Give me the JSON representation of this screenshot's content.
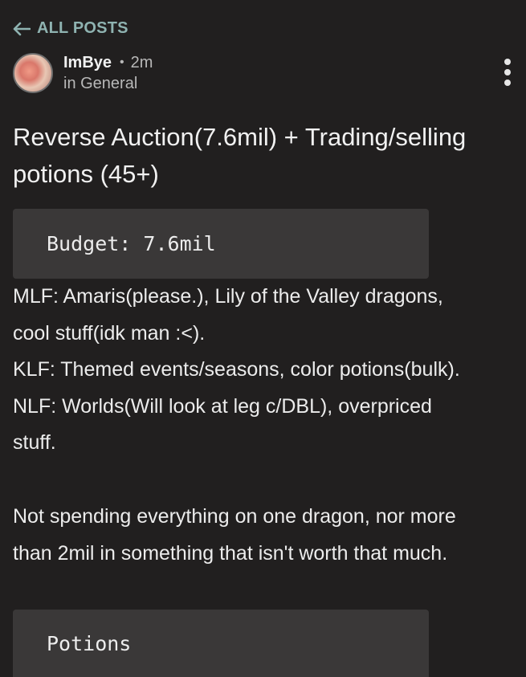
{
  "nav": {
    "back_label": "ALL POSTS"
  },
  "post": {
    "author": "ImBye",
    "separator": "•",
    "time": "2m",
    "category": "in General",
    "title": "Reverse Auction(7.6mil) + Trading/selling potions (45+)",
    "budget_code": "Budget: 7.6mil",
    "lines": [
      "MLF: Amaris(please.), Lily of the Valley dragons,",
      "cool stuff(idk man :<).",
      "KLF: Themed events/seasons, color potions(bulk).",
      "NLF: Worlds(Will look at leg c/DBL), overpriced",
      "stuff."
    ],
    "paragraph2_lines": [
      "Not spending everything on one dragon, nor more",
      "than 2mil in something that isn't worth that much."
    ],
    "potions_code": "Potions"
  },
  "icons": {
    "back": "arrow-left-icon",
    "more": "more-vertical-icon",
    "avatar": "user-avatar"
  },
  "colors": {
    "background": "#211f1f",
    "accent": "#8fb3b1",
    "code_bg": "#3a3838",
    "muted": "#b8b8b8"
  }
}
